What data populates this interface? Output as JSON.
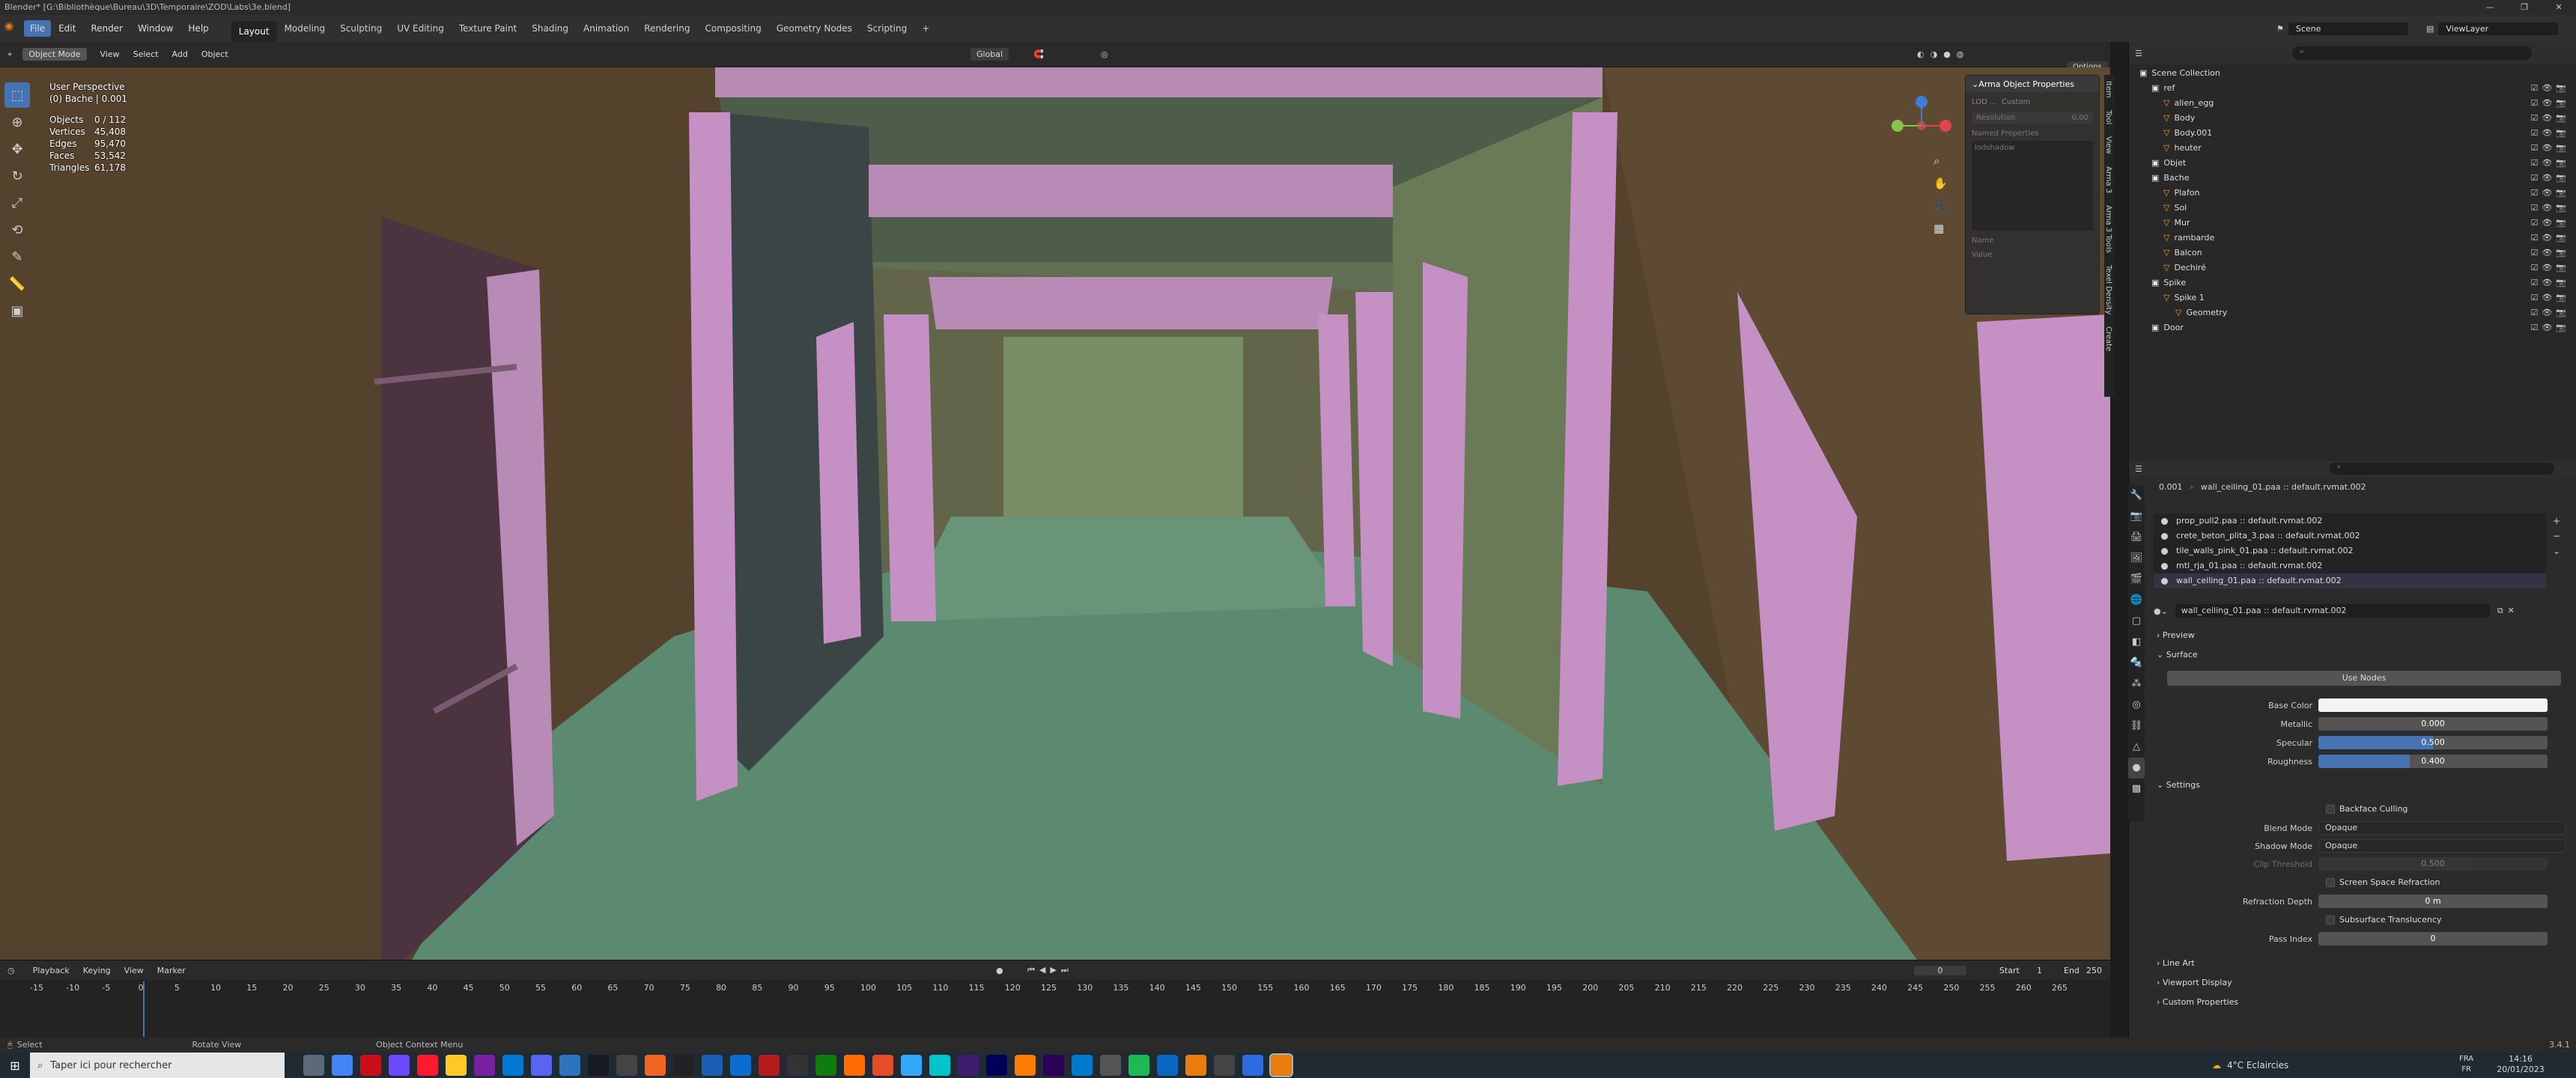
{
  "window": {
    "title": "Blender* [G:\\Bibliothèque\\Bureau\\3D\\Temporaire\\ZOD\\Labs\\3e.blend]",
    "controls": [
      "—",
      "❐",
      "✕"
    ]
  },
  "menus": [
    "File",
    "Edit",
    "Render",
    "Window",
    "Help"
  ],
  "workspaces": [
    "Layout",
    "Modeling",
    "Sculpting",
    "UV Editing",
    "Texture Paint",
    "Shading",
    "Animation",
    "Rendering",
    "Compositing",
    "Geometry Nodes",
    "Scripting",
    "+"
  ],
  "scene": {
    "name": "Scene",
    "view_layer": "ViewLayer"
  },
  "viewport_header": {
    "mode": "Object Mode",
    "menus": [
      "View",
      "Select",
      "Add",
      "Object"
    ],
    "transform": "Global",
    "options": "Options"
  },
  "viewport_overlay": {
    "perspective": "User Perspective",
    "object": "(0) Bache | 0.001",
    "stats": [
      {
        "label": "Objects",
        "value": "0 / 112"
      },
      {
        "label": "Vertices",
        "value": "45,408"
      },
      {
        "label": "Edges",
        "value": "95,470"
      },
      {
        "label": "Faces",
        "value": "53,542"
      },
      {
        "label": "Triangles",
        "value": "61,178"
      }
    ]
  },
  "npanel": {
    "title": "Arma Object Properties",
    "lod_label": "LOD ...",
    "lod_value": "Custom",
    "resolution_label": "Resolution",
    "resolution_value": "0.00",
    "named_props": "Named Properties",
    "shadow": "lodshadow",
    "name_label": "Name",
    "value_label": "Value",
    "tabs": [
      "Item",
      "Tool",
      "View",
      "Arma 3",
      "Arma 3 Tools",
      "Texel Density",
      "Create"
    ]
  },
  "timeline": {
    "menus": [
      "Playback",
      "Keying",
      "View",
      "Marker"
    ],
    "current_frame": "0",
    "start_label": "Start",
    "start": "1",
    "end_label": "End",
    "end": "250",
    "ticks": [
      "-15",
      "-10",
      "-5",
      "0",
      "5",
      "10",
      "15",
      "20",
      "25",
      "30",
      "35",
      "40",
      "45",
      "50",
      "55",
      "60",
      "65",
      "70",
      "75",
      "80",
      "85",
      "90",
      "95",
      "100",
      "105",
      "110",
      "115",
      "120",
      "125",
      "130",
      "135",
      "140",
      "145",
      "150",
      "155",
      "160",
      "165",
      "170",
      "175",
      "180",
      "185",
      "190",
      "195",
      "200",
      "205",
      "210",
      "215",
      "220",
      "225",
      "230",
      "235",
      "240",
      "245",
      "250",
      "255",
      "260",
      "265"
    ]
  },
  "statusbar": {
    "select": "Select",
    "rotate": "Rotate View",
    "context": "Object Context Menu",
    "version": "3.4.1"
  },
  "outliner": {
    "items": [
      {
        "name": "Scene Collection",
        "indent": 0
      },
      {
        "name": "ref",
        "indent": 1
      },
      {
        "name": "alien_egg",
        "indent": 2
      },
      {
        "name": "Body",
        "indent": 2
      },
      {
        "name": "Body.001",
        "indent": 2
      },
      {
        "name": "heuter",
        "indent": 2
      },
      {
        "name": "Objet",
        "indent": 1
      },
      {
        "name": "Bache",
        "indent": 1
      },
      {
        "name": "Plafon",
        "indent": 2
      },
      {
        "name": "Sol",
        "indent": 2
      },
      {
        "name": "Mur",
        "indent": 2
      },
      {
        "name": "rambarde",
        "indent": 2
      },
      {
        "name": "Balcon",
        "indent": 2
      },
      {
        "name": "Dechiré",
        "indent": 2
      },
      {
        "name": "Spike",
        "indent": 1
      },
      {
        "name": "Spike 1",
        "indent": 2
      },
      {
        "name": "Geometry",
        "indent": 3
      },
      {
        "name": "Door",
        "indent": 1
      }
    ]
  },
  "properties": {
    "breadcrumb_obj": "0.001",
    "breadcrumb_mat": "wall_ceiling_01.paa :: default.rvmat.002",
    "materials": [
      "prop_pull2.paa :: default.rvmat.002",
      "crete_beton_plita_3.paa :: default.rvmat.002",
      "tile_walls_pink_01.paa :: default.rvmat.002",
      "mtl_rja_01.paa :: default.rvmat.002",
      "wall_ceiling_01.paa :: default.rvmat.002"
    ],
    "active_material": "wall_ceiling_01.paa :: default.rvmat.002",
    "preview": "Preview",
    "surface": "Surface",
    "use_nodes": "Use Nodes",
    "base_color_label": "Base Color",
    "metallic_label": "Metallic",
    "metallic": "0.000",
    "metallic_fill": 0.0,
    "specular_label": "Specular",
    "specular": "0.500",
    "specular_fill": 0.5,
    "roughness_label": "Roughness",
    "roughness": "0.400",
    "roughness_fill": 0.4,
    "settings": "Settings",
    "backface": "Backface Culling",
    "blend_label": "Blend Mode",
    "blend": "Opaque",
    "shadow_label": "Shadow Mode",
    "shadow": "Opaque",
    "clip_label": "Clip Threshold",
    "clip": "0.500",
    "ssr": "Screen Space Refraction",
    "refraction_label": "Refraction Depth",
    "refraction": "0 m",
    "sss": "Subsurface Translucency",
    "pass_label": "Pass Index",
    "pass": "0",
    "line_art": "Line Art",
    "viewport_display": "Viewport Display",
    "custom_props": "Custom Properties"
  },
  "taskbar": {
    "search": "Taper ici pour rechercher",
    "weather": "4°C  Eclaircies",
    "lang": "FRA",
    "lang2": "FR",
    "time": "14:16",
    "date": "20/01/2023"
  }
}
